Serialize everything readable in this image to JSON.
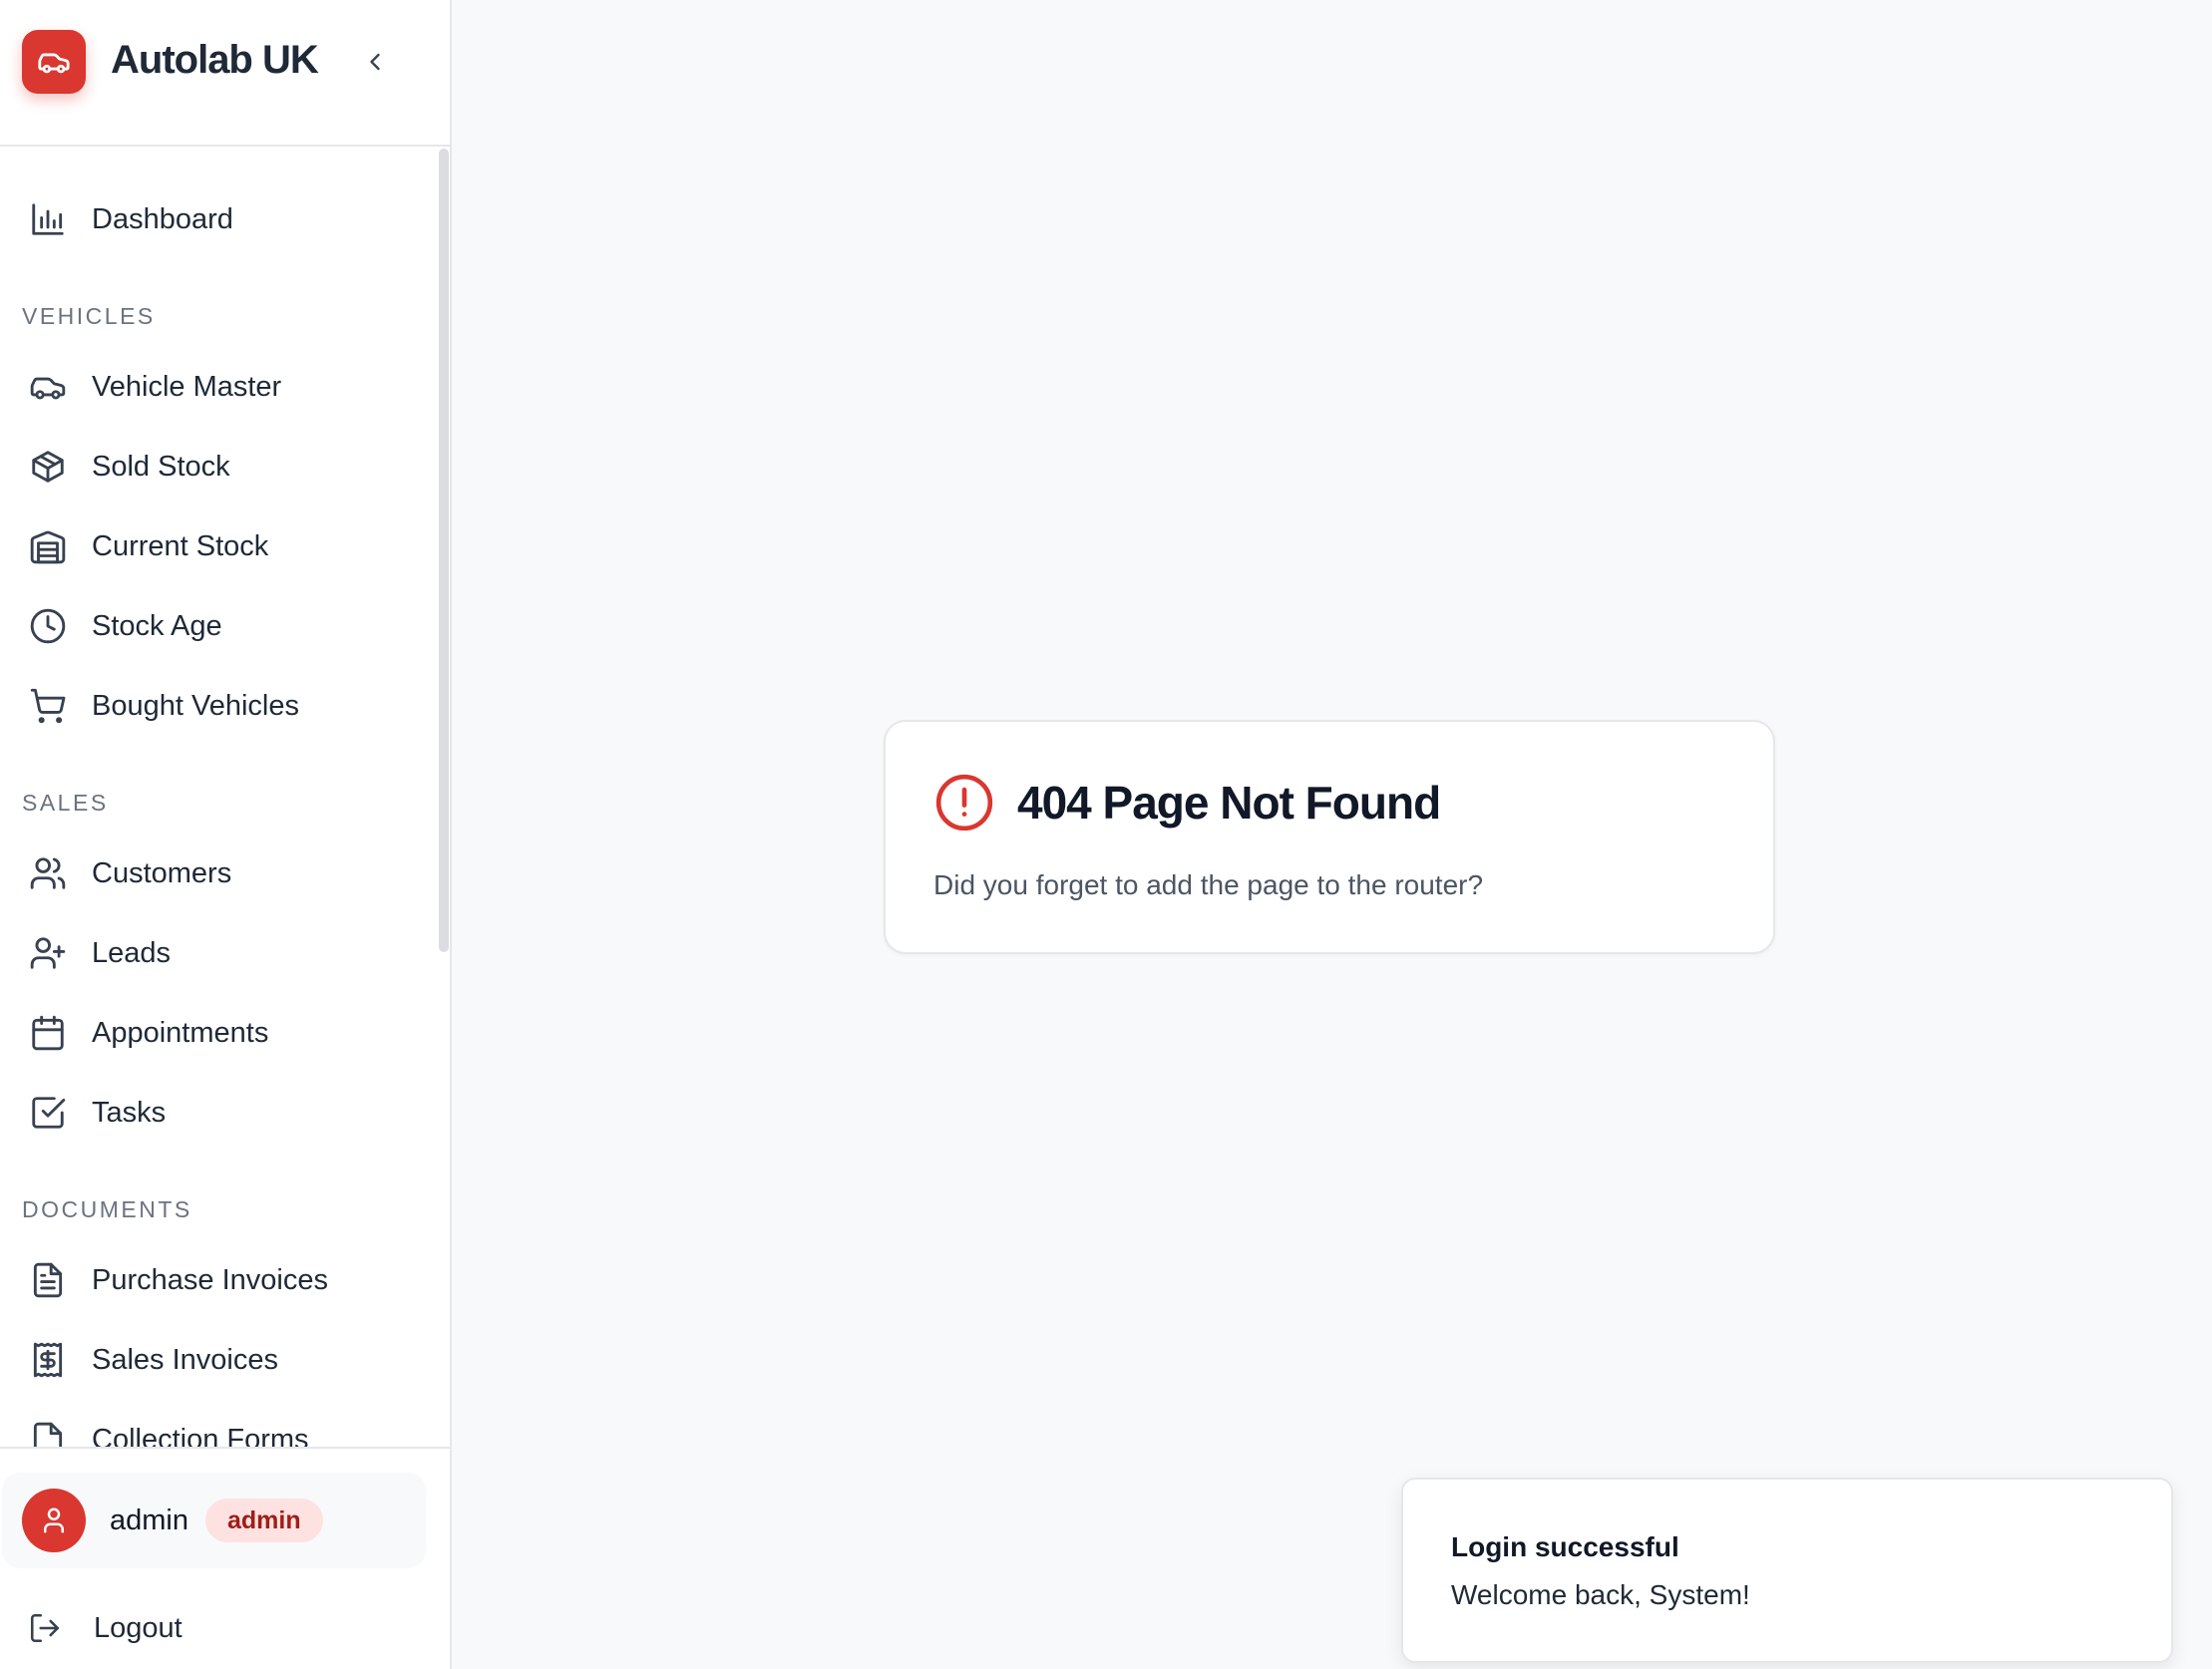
{
  "brand": {
    "name": "Autolab UK"
  },
  "sidebar": {
    "dashboard": "Dashboard",
    "sections": {
      "vehicles": "VEHICLES",
      "sales": "SALES",
      "documents": "DOCUMENTS"
    },
    "vehicles": [
      "Vehicle Master",
      "Sold Stock",
      "Current Stock",
      "Stock Age",
      "Bought Vehicles"
    ],
    "sales": [
      "Customers",
      "Leads",
      "Appointments",
      "Tasks"
    ],
    "documents": [
      "Purchase Invoices",
      "Sales Invoices",
      "Collection Forms"
    ]
  },
  "user": {
    "name": "admin",
    "role": "admin"
  },
  "logout_label": "Logout",
  "error": {
    "title": "404 Page Not Found",
    "message": "Did you forget to add the page to the router?"
  },
  "toast": {
    "title": "Login successful",
    "message": "Welcome back, System!"
  },
  "colors": {
    "accent": "#d9372f",
    "badge_bg": "#fde2e1",
    "badge_text": "#a11d17"
  },
  "icons": {
    "brand": "car-icon",
    "collapse": "chevron-left-icon",
    "dashboard": "bar-chart-icon",
    "vehicle_master": "car-icon",
    "sold_stock": "package-icon",
    "current_stock": "warehouse-icon",
    "stock_age": "clock-icon",
    "bought_vehicles": "cart-icon",
    "customers": "users-icon",
    "leads": "user-plus-icon",
    "appointments": "calendar-icon",
    "tasks": "check-square-icon",
    "purchase_invoices": "file-text-icon",
    "sales_invoices": "receipt-icon",
    "collection_forms": "file-icon",
    "logout": "logout-icon",
    "error": "alert-circle-icon",
    "avatar": "user-icon"
  }
}
